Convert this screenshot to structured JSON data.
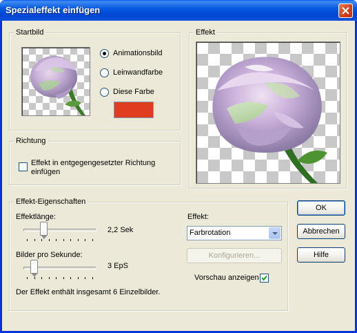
{
  "window": {
    "title": "Spezialeffekt einfügen"
  },
  "startbild": {
    "title": "Startbild",
    "options": [
      {
        "label": "Animationsbild",
        "checked": true
      },
      {
        "label": "Leinwandfarbe",
        "checked": false
      },
      {
        "label": "Diese Farbe",
        "checked": false
      }
    ],
    "swatch_color": "#e03c1f"
  },
  "effekt_preview": {
    "title": "Effekt"
  },
  "richtung": {
    "title": "Richtung",
    "checkbox_label_line1": "Effekt in entgegengesetzter Richtung",
    "checkbox_label_line2": "einfügen",
    "checked": false
  },
  "eigenschaften": {
    "title": "Effekt-Eigenschaften",
    "laenge_label": "Effektlänge:",
    "laenge_value": "2,2 Sek",
    "laenge_level": 0.25,
    "bps_label": "Bilder pro Sekunde:",
    "bps_value": "3 EpS",
    "bps_level": 0.1,
    "summary": "Der Effekt enthält insgesamt 6 Einzelbilder.",
    "effekt_label": "Effekt:",
    "effekt_selected": "Farbrotation",
    "configure_label": "Konfigurieren...",
    "preview_label": "Vorschau anzeigen",
    "preview_checked": true
  },
  "buttons": {
    "ok": "OK",
    "cancel": "Abbrechen",
    "help": "Hilfe"
  },
  "icons": {
    "close": "close-icon",
    "check": "checkmark-icon"
  }
}
